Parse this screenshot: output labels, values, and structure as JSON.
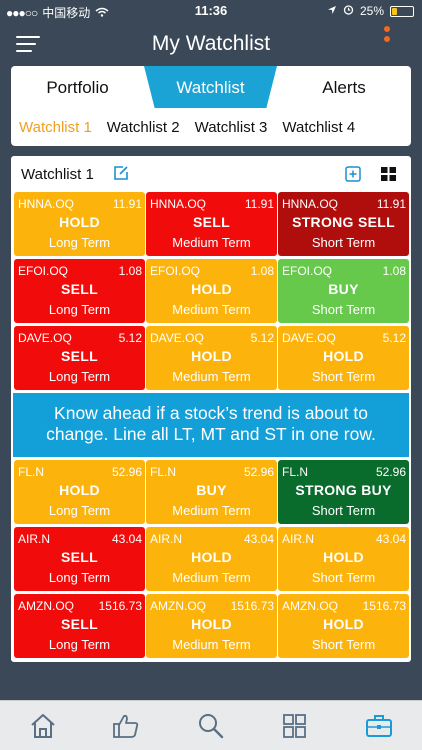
{
  "status_bar": {
    "carrier": "中国移动",
    "time": "11:36",
    "battery": "25%",
    "battery_level": 0.25
  },
  "nav": {
    "title": "My Watchlist",
    "menu_icon": "hamburger-menu-icon",
    "more_icon": "more-dots-icon"
  },
  "main_tabs": [
    {
      "label": "Portfolio"
    },
    {
      "label": "Watchlist"
    },
    {
      "label": "Alerts"
    }
  ],
  "sub_tabs": [
    {
      "label": "Watchlist 1"
    },
    {
      "label": "Watchlist 2"
    },
    {
      "label": "Watchlist 3"
    },
    {
      "label": "Watchlist 4"
    }
  ],
  "panel": {
    "title": "Watchlist 1"
  },
  "colors": {
    "hold": "#fcb40c",
    "sell": "#f20b0b",
    "strong_sell": "#b00d0d",
    "buy": "#67c94c",
    "strong_buy": "#0a6c2c",
    "accent": "#1aa3d4",
    "active_subtab": "#f0a020"
  },
  "tiles": [
    {
      "symbol": "HNNA.OQ",
      "price": "11.91",
      "signal": "HOLD",
      "term": "Long Term",
      "kind": "hold"
    },
    {
      "symbol": "HNNA.OQ",
      "price": "11.91",
      "signal": "SELL",
      "term": "Medium Term",
      "kind": "sell"
    },
    {
      "symbol": "HNNA.OQ",
      "price": "11.91",
      "signal": "STRONG SELL",
      "term": "Short Term",
      "kind": "strong_sell"
    },
    {
      "symbol": "EFOI.OQ",
      "price": "1.08",
      "signal": "SELL",
      "term": "Long Term",
      "kind": "sell"
    },
    {
      "symbol": "EFOI.OQ",
      "price": "1.08",
      "signal": "HOLD",
      "term": "Medium Term",
      "kind": "hold"
    },
    {
      "symbol": "EFOI.OQ",
      "price": "1.08",
      "signal": "BUY",
      "term": "Short Term",
      "kind": "buy"
    },
    {
      "symbol": "DAVE.OQ",
      "price": "5.12",
      "signal": "SELL",
      "term": "Long Term",
      "kind": "sell"
    },
    {
      "symbol": "DAVE.OQ",
      "price": "5.12",
      "signal": "HOLD",
      "term": "Medium Term",
      "kind": "hold"
    },
    {
      "symbol": "DAVE.OQ",
      "price": "5.12",
      "signal": "HOLD",
      "term": "Short Term",
      "kind": "hold"
    },
    {
      "symbol": "FL.N",
      "price": "52.96",
      "signal": "HOLD",
      "term": "Long Term",
      "kind": "hold"
    },
    {
      "symbol": "FL.N",
      "price": "52.96",
      "signal": "BUY",
      "term": "Medium Term",
      "kind": "hold"
    },
    {
      "symbol": "FL.N",
      "price": "52.96",
      "signal": "STRONG BUY",
      "term": "Short Term",
      "kind": "strong_buy"
    },
    {
      "symbol": "AIR.N",
      "price": "43.04",
      "signal": "SELL",
      "term": "Long Term",
      "kind": "sell"
    },
    {
      "symbol": "AIR.N",
      "price": "43.04",
      "signal": "HOLD",
      "term": "Medium Term",
      "kind": "hold"
    },
    {
      "symbol": "AIR.N",
      "price": "43.04",
      "signal": "HOLD",
      "term": "Short Term",
      "kind": "hold"
    },
    {
      "symbol": "AMZN.OQ",
      "price": "1516.73",
      "signal": "SELL",
      "term": "Long Term",
      "kind": "sell"
    },
    {
      "symbol": "AMZN.OQ",
      "price": "1516.73",
      "signal": "HOLD",
      "term": "Medium Term",
      "kind": "hold"
    },
    {
      "symbol": "AMZN.OQ",
      "price": "1516.73",
      "signal": "HOLD",
      "term": "Short Term",
      "kind": "hold"
    }
  ],
  "banner": {
    "line1": "Know ahead if a stock’s trend is about to",
    "line2": "change. Line all LT, MT and ST in one row."
  },
  "bottom_nav": [
    {
      "icon": "home-icon"
    },
    {
      "icon": "thumbs-up-icon"
    },
    {
      "icon": "search-icon"
    },
    {
      "icon": "dashboard-grid-icon"
    },
    {
      "icon": "briefcase-icon"
    }
  ]
}
